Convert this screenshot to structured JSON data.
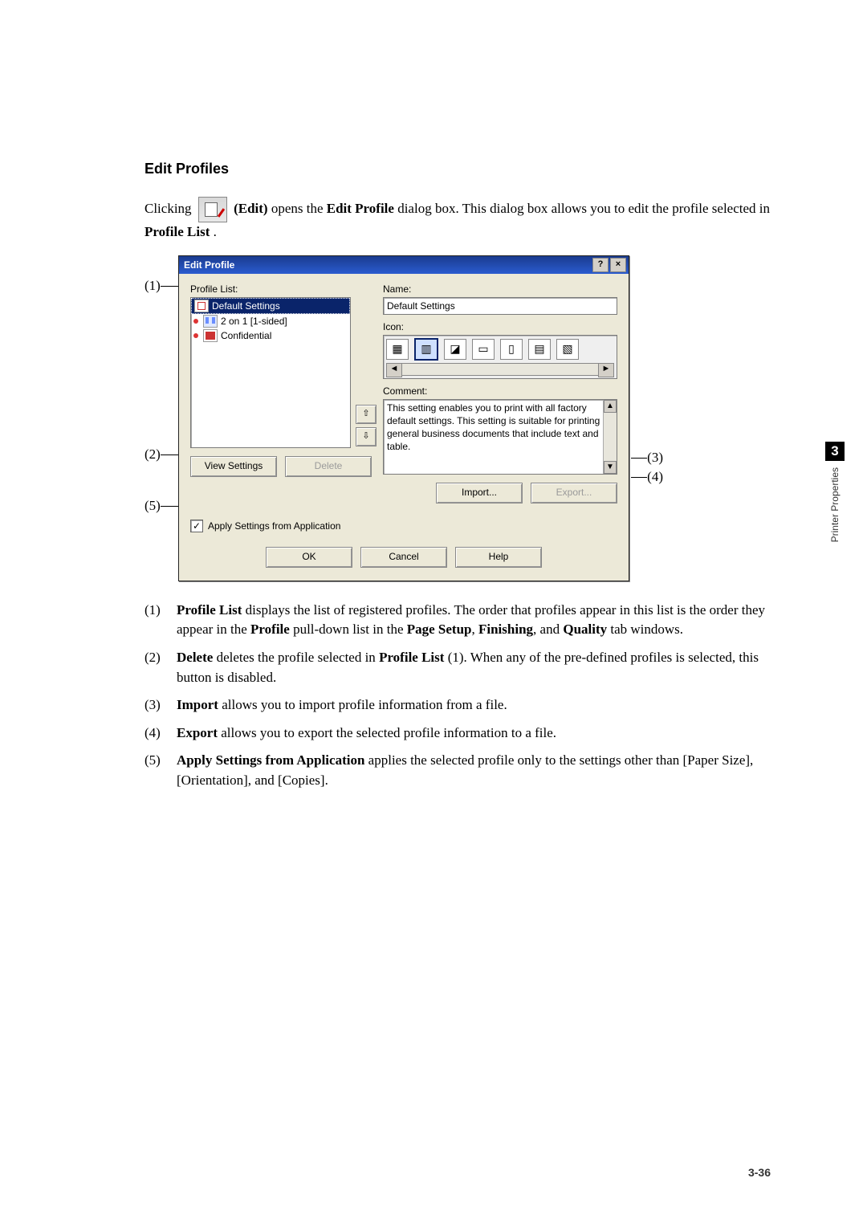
{
  "section": {
    "heading": "Edit Profiles"
  },
  "intro": {
    "p1a": "Clicking ",
    "p1b": " (Edit)",
    "p1c": " opens the ",
    "p1d": "Edit Profile",
    "p1e": " dialog box. This dialog box allows you to edit the profile selected in ",
    "p1f": "Profile List",
    "p1g": "."
  },
  "callouts": {
    "c1": "(1)",
    "c2": "(2)",
    "c3": "(3)",
    "c4": "(4)",
    "c5": "(5)"
  },
  "dialog": {
    "title": "Edit Profile",
    "help_btn": "?",
    "close_btn": "×",
    "left": {
      "list_label": "Profile List:",
      "items": [
        "Default Settings",
        "2 on 1 [1-sided]",
        "Confidential"
      ],
      "view_settings": "View Settings",
      "delete": "Delete",
      "move_up": "▲",
      "move_down": "▼"
    },
    "right": {
      "name_label": "Name:",
      "name_value": "Default Settings",
      "icon_label": "Icon:",
      "comment_label": "Comment:",
      "comment_value": "This setting enables you to print with all factory default settings. This setting is suitable for printing general business documents that include text and table.",
      "import": "Import...",
      "export": "Export..."
    },
    "apply_label": "Apply Settings from Application",
    "apply_checked": "✓",
    "ok": "OK",
    "cancel": "Cancel",
    "help": "Help",
    "scroll_up": "▲",
    "scroll_down": "▼",
    "scroll_left": "◄",
    "scroll_right": "►"
  },
  "desc": {
    "d1_num": "(1)",
    "d1_a": "Profile List",
    "d1_b": " displays the list of registered profiles. The order that profiles appear in this list is the order they appear in the ",
    "d1_c": "Profile",
    "d1_d": " pull-down list in the ",
    "d1_e": "Page Setup",
    "d1_f": ", ",
    "d1_g": "Finishing",
    "d1_h": ", and ",
    "d1_i": "Quality",
    "d1_j": " tab windows.",
    "d2_num": "(2)",
    "d2_a": "Delete",
    "d2_b": " deletes the profile selected in ",
    "d2_c": "Profile List",
    "d2_d": " (1). When any of the pre-defined profiles is selected, this button is disabled.",
    "d3_num": "(3)",
    "d3_a": "Import",
    "d3_b": " allows you to import profile information from a file.",
    "d4_num": "(4)",
    "d4_a": "Export",
    "d4_b": " allows you to export the selected profile information to a file.",
    "d5_num": "(5)",
    "d5_a": "Apply Settings from Application",
    "d5_b": " applies the selected profile only to the settings other than [Paper Size], [Orientation], and [Copies]."
  },
  "side": {
    "chapter": "3",
    "label": "Printer Properties"
  },
  "footer": {
    "page": "3-36"
  }
}
